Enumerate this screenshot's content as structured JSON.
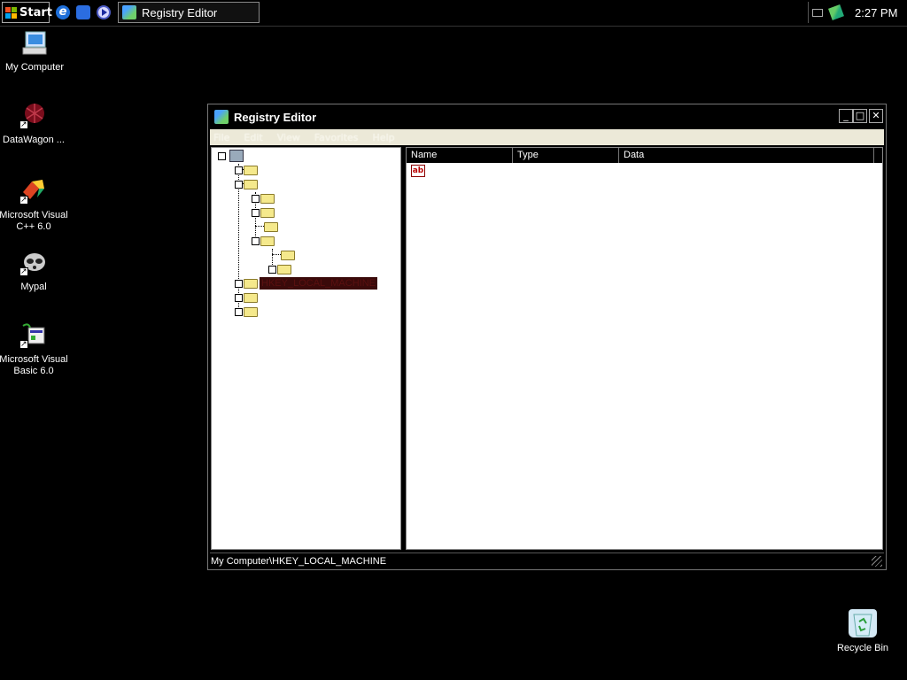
{
  "taskbar": {
    "start_label": "Start",
    "quicklaunch": [
      {
        "name": "internet-explorer",
        "icon": "ie-icon"
      },
      {
        "name": "outlook-express",
        "icon": "outlook-icon"
      },
      {
        "name": "media-player",
        "icon": "media-player-icon"
      }
    ],
    "active_task_label": "Registry Editor",
    "clock": "2:27 PM"
  },
  "desktop": {
    "icons": [
      {
        "label": "My Computer",
        "icon": "my-computer-icon"
      },
      {
        "label": "DataWagon ...",
        "icon": "datawagon-icon"
      },
      {
        "label": "Microsoft Visual C++ 6.0",
        "icon": "visual-cpp-icon"
      },
      {
        "label": "Mypal",
        "icon": "mypal-icon"
      },
      {
        "label": "Microsoft Visual Basic 6.0",
        "icon": "visual-basic-icon"
      },
      {
        "label": "Recycle Bin",
        "icon": "recycle-bin-icon"
      }
    ]
  },
  "window": {
    "title": "Registry Editor",
    "menu": [
      "File",
      "Edit",
      "View",
      "Favorites",
      "Help"
    ],
    "tree": {
      "selected_label": "HKEY_LOCAL_MACHINE"
    },
    "list": {
      "columns": [
        "Name",
        "Type",
        "Data"
      ]
    },
    "status": "My Computer\\HKEY_LOCAL_MACHINE"
  },
  "colors": {
    "background": "#000000",
    "menubar": "#ece9d8",
    "folder": "#f5e98c"
  }
}
